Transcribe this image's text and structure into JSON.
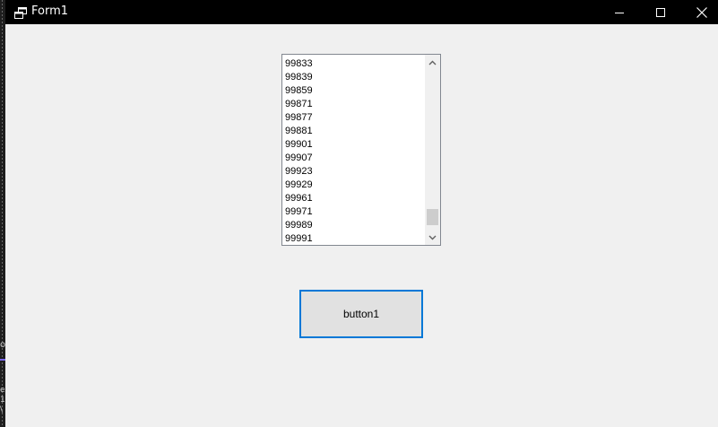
{
  "window": {
    "title": "Form1",
    "icons": {
      "app": "form-window-icon",
      "minimize": "minimize-icon",
      "maximize": "maximize-icon",
      "close": "close-icon"
    }
  },
  "listbox": {
    "items": [
      "99833",
      "99839",
      "99859",
      "99871",
      "99877",
      "99881",
      "99901",
      "99907",
      "99923",
      "99929",
      "99961",
      "99971",
      "99989",
      "99991"
    ],
    "scroll_position": 0.97,
    "icons": {
      "up": "chevron-up-icon",
      "down": "chevron-down-icon"
    }
  },
  "button1": {
    "label": "button1"
  },
  "colors": {
    "titlebar": "#000000",
    "background": "#f0f0f0",
    "button_border_focus": "#0078d7",
    "button_face": "#e1e1e1"
  }
}
